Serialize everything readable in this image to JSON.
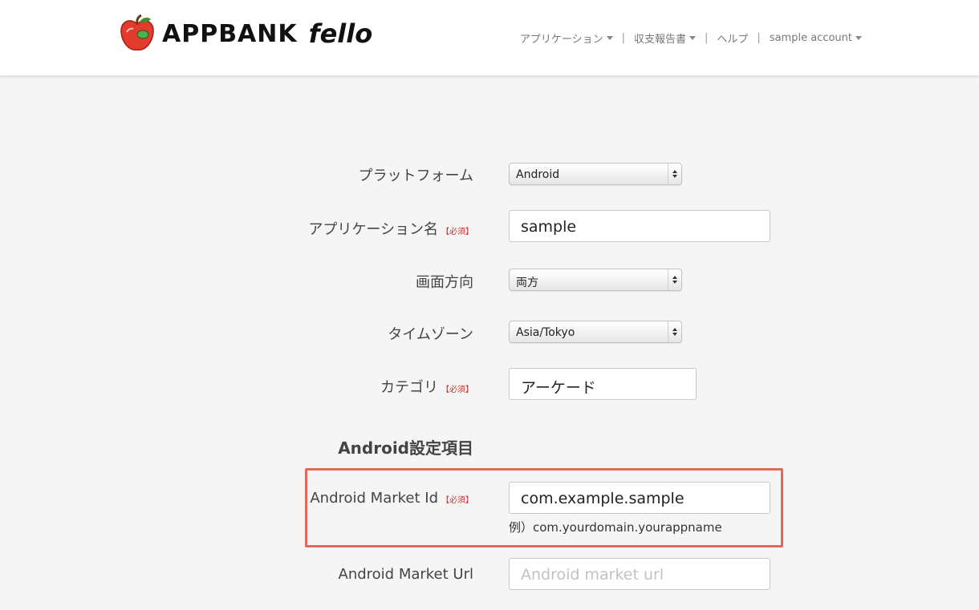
{
  "header": {
    "brand": "APPBANK",
    "brand_sub": "fello",
    "nav": [
      {
        "label": "アプリケーション",
        "dropdown": true
      },
      {
        "label": "収支報告書",
        "dropdown": true
      },
      {
        "label": "ヘルプ",
        "dropdown": false
      },
      {
        "label": "sample account",
        "dropdown": true
      }
    ],
    "separator": "|"
  },
  "form": {
    "platform": {
      "label": "プラットフォーム",
      "value": "Android"
    },
    "app_name": {
      "label": "アプリケーション名",
      "required": "【必須】",
      "value": "sample"
    },
    "orientation": {
      "label": "画面方向",
      "value": "両方"
    },
    "timezone": {
      "label": "タイムゾーン",
      "value": "Asia/Tokyo"
    },
    "category": {
      "label": "カテゴリ",
      "required": "【必須】",
      "value": "アーケード"
    },
    "android_section_title": "Android設定項目",
    "market_id": {
      "label": "Android Market Id",
      "required": "【必須】",
      "value": "com.example.sample",
      "hint": "例）com.yourdomain.yourappname"
    },
    "market_url": {
      "label": "Android Market Url",
      "placeholder": "Android market url"
    }
  },
  "colors": {
    "highlight": "#e0695a",
    "required": "#d32f2f"
  }
}
